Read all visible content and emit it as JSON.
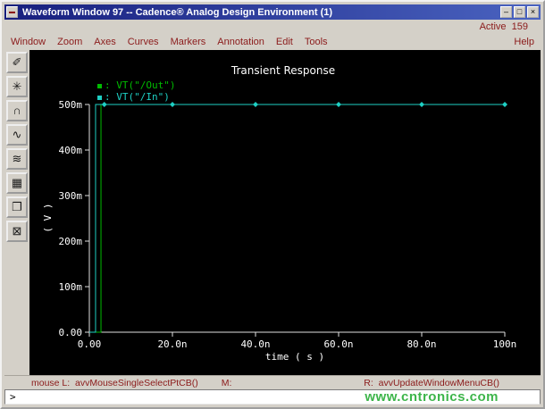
{
  "window": {
    "title": "Waveform Window 97 -- Cadence® Analog Design Environment (1)",
    "controls": {
      "menu": "▬",
      "minimize": "–",
      "maximize": "□",
      "close": "×"
    }
  },
  "active_label": "Active  159",
  "menubar": {
    "items": [
      "Window",
      "Zoom",
      "Axes",
      "Curves",
      "Markers",
      "Annotation",
      "Edit",
      "Tools"
    ],
    "help": "Help"
  },
  "toolbar": {
    "buttons": [
      {
        "name": "probe-pen-icon",
        "glyph": "✐"
      },
      {
        "name": "zoom-fit-icon",
        "glyph": "✳"
      },
      {
        "name": "redraw-icon",
        "glyph": "∩"
      },
      {
        "name": "strip-chart-icon",
        "glyph": "∿"
      },
      {
        "name": "split-curves-icon",
        "glyph": "≋"
      },
      {
        "name": "calculator-icon",
        "glyph": "▦"
      },
      {
        "name": "copy-window-icon",
        "glyph": "❐"
      },
      {
        "name": "delete-icon",
        "glyph": "⊠"
      }
    ]
  },
  "chart_data": {
    "type": "line",
    "title": "Transient Response",
    "xlabel": "time ( s )",
    "ylabel": "( V )",
    "background": "#000000",
    "axis_color": "#e0e0e0",
    "text_color": "#ffffff",
    "grid": false,
    "legend_position": "top-left",
    "xlim_ns": [
      0,
      100
    ],
    "ylim_v": [
      0,
      0.5
    ],
    "x_ticks": [
      {
        "v": 0,
        "label": "0.00"
      },
      {
        "v": 20,
        "label": "20.0n"
      },
      {
        "v": 40,
        "label": "40.0n"
      },
      {
        "v": 60,
        "label": "60.0n"
      },
      {
        "v": 80,
        "label": "80.0n"
      },
      {
        "v": 100,
        "label": "100n"
      }
    ],
    "y_ticks": [
      {
        "v": 0.0,
        "label": "0.00"
      },
      {
        "v": 0.1,
        "label": "100m"
      },
      {
        "v": 0.2,
        "label": "200m"
      },
      {
        "v": 0.3,
        "label": "300m"
      },
      {
        "v": 0.4,
        "label": "400m"
      },
      {
        "v": 0.5,
        "label": "500m"
      }
    ],
    "series": [
      {
        "name": "VT(\"/Out\")",
        "color": "#00bb00",
        "marker": "none",
        "points_ns_v": [
          [
            0,
            0
          ],
          [
            2.8,
            0
          ],
          [
            2.8,
            0.5
          ],
          [
            100,
            0.5
          ]
        ]
      },
      {
        "name": "VT(\"/In\")",
        "color": "#1ecfc3",
        "marker": "diamond",
        "points_ns_v": [
          [
            0,
            0
          ],
          [
            1.5,
            0
          ],
          [
            1.5,
            0.5
          ],
          [
            100,
            0.5
          ]
        ],
        "marker_points_ns_v": [
          [
            3.6,
            0.5
          ],
          [
            20,
            0.5
          ],
          [
            40,
            0.5
          ],
          [
            60,
            0.5
          ],
          [
            80,
            0.5
          ],
          [
            100,
            0.5
          ]
        ]
      }
    ]
  },
  "statusbar": {
    "mouse_left": "mouse L:  avvMouseSingleSelectPtCB()",
    "mouse_middle": "M:",
    "mouse_right": "R:  avvUpdateWindowMenuCB()"
  },
  "prompt": ">",
  "watermark": {
    "text": "www.cntronics.com"
  },
  "colors": {
    "titlebar_left": "#171f7e",
    "titlebar_right": "#4a63c0",
    "menu_text": "#8b1a1a",
    "plot_bg": "#000000",
    "watermark": "#3db54a"
  }
}
